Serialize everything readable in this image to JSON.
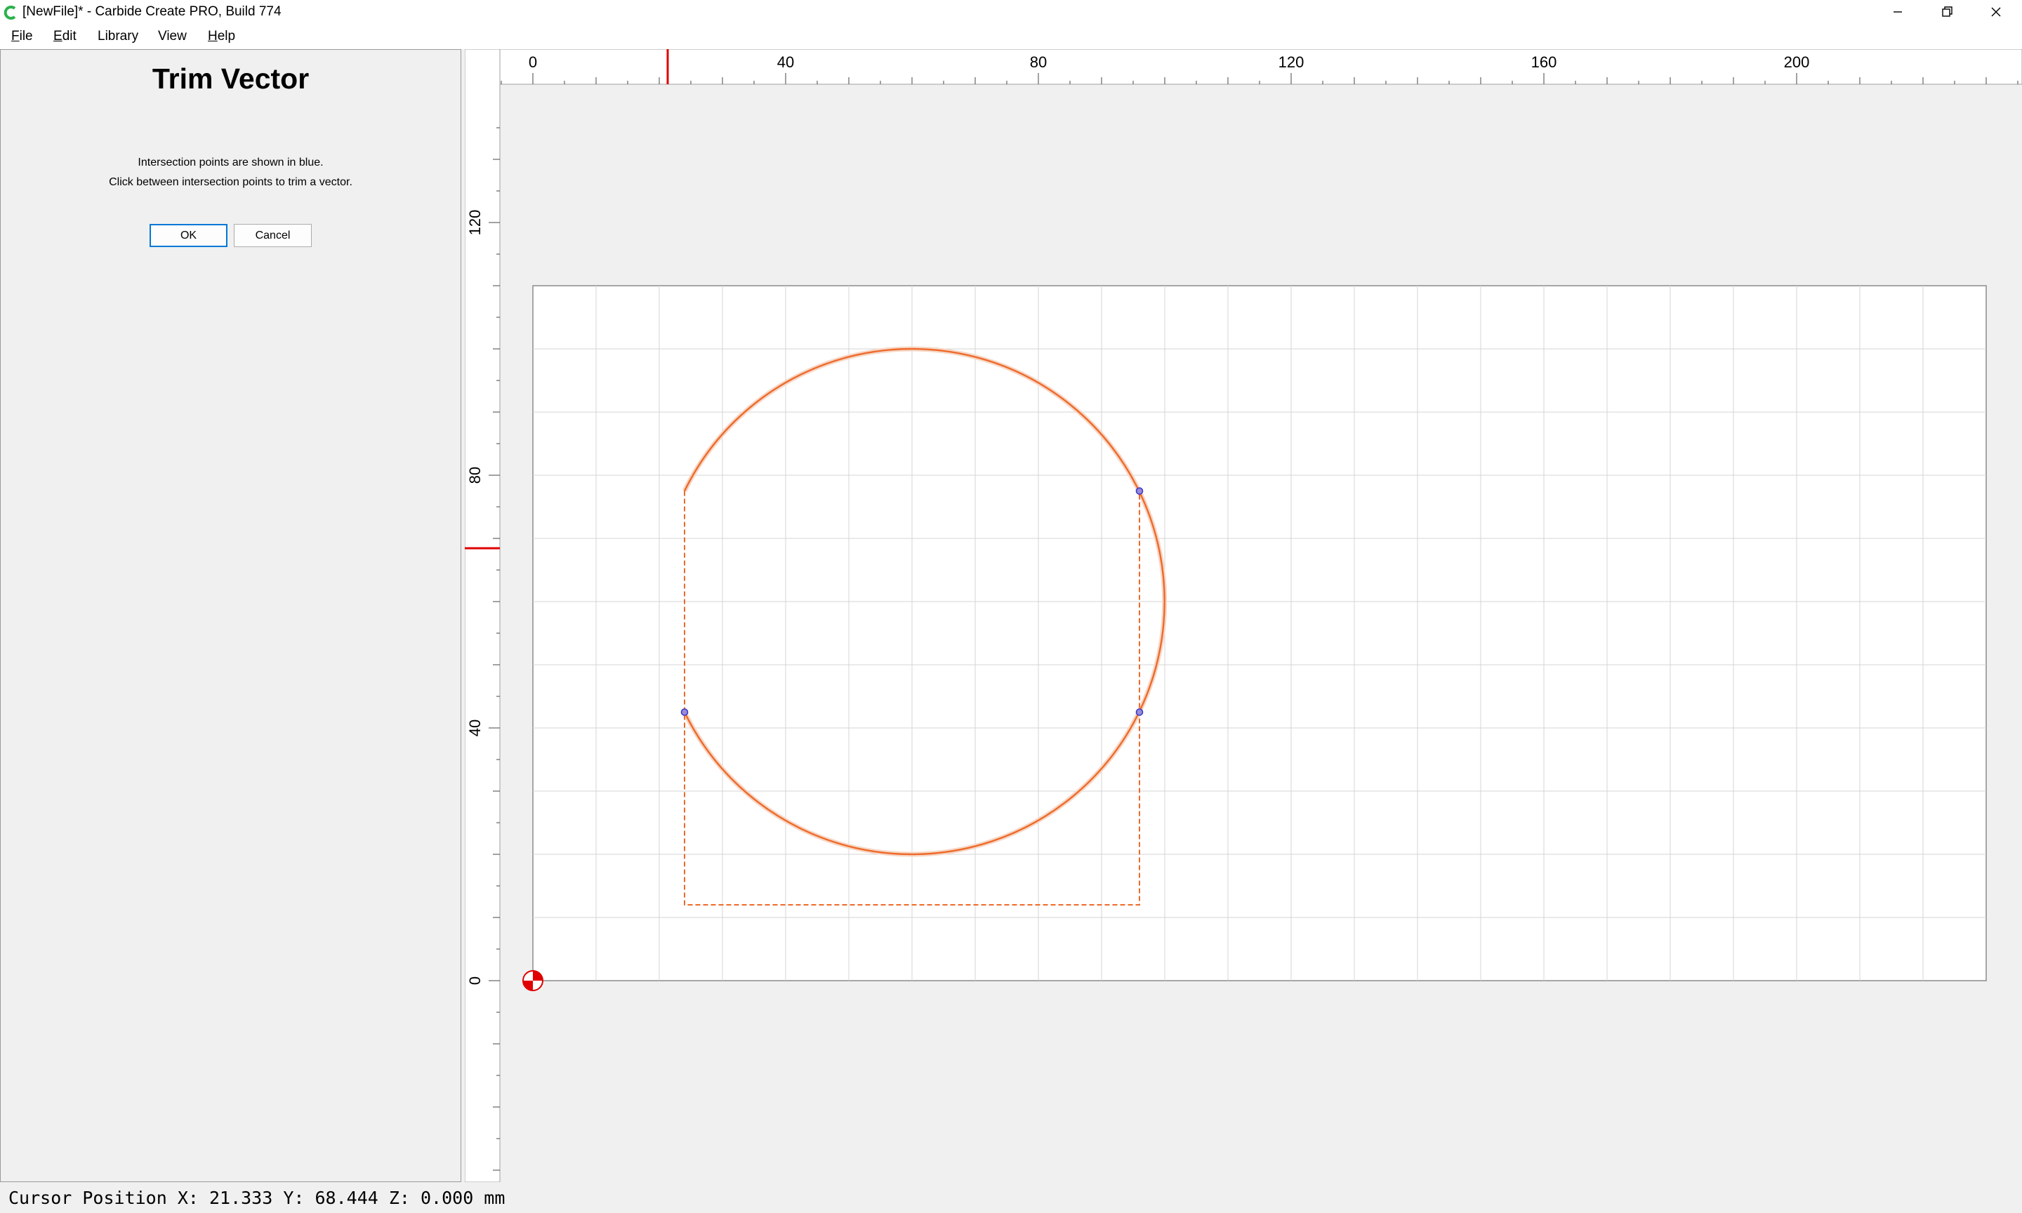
{
  "window": {
    "title": "[NewFile]* - Carbide Create PRO, Build 774",
    "icon": "carbide-c-icon",
    "controls": [
      "minimize-icon",
      "restore-icon",
      "close-icon"
    ]
  },
  "menu": {
    "items": [
      {
        "label": "File",
        "hotkey": "F",
        "rest": "ile"
      },
      {
        "label": "Edit",
        "hotkey": "E",
        "rest": "dit"
      },
      {
        "label": "Library",
        "hotkey": "",
        "rest": "Library"
      },
      {
        "label": "View",
        "hotkey": "",
        "rest": "View"
      },
      {
        "label": "Help",
        "hotkey": "H",
        "rest": "elp"
      }
    ]
  },
  "panel": {
    "title": "Trim Vector",
    "info_line_1": "Intersection points are shown in blue.",
    "info_line_2": "Click between intersection points to trim a vector.",
    "ok_label": "OK",
    "cancel_label": "Cancel"
  },
  "canvas": {
    "units": "mm",
    "stock_width": 230,
    "stock_height": 110,
    "grid_step": 10,
    "x_ticks": [
      "0",
      "40",
      "80",
      "120",
      "160",
      "200"
    ],
    "y_ticks": [
      "0",
      "40",
      "80",
      "120"
    ],
    "cursor_marker": {
      "x": 21.333,
      "y": 68.444
    },
    "circle": {
      "cx": 60,
      "cy": 60,
      "r": 40
    },
    "trimmed_rect": {
      "x0": 24,
      "y0": 12,
      "x1": 96,
      "y1": 77.5
    },
    "intersection_points": [
      {
        "x": 96,
        "y": 77.5
      },
      {
        "x": 24,
        "y": 42.5
      },
      {
        "x": 96,
        "y": 42.5
      }
    ],
    "colors": {
      "vector": "#ee6a2a",
      "intersection": "#3c3cc8",
      "grid": "#d4d4d4",
      "cursor": "#e00000",
      "origin": "#e00000"
    }
  },
  "status": {
    "cursor_position": "Cursor Position X: 21.333 Y: 68.444 Z: 0.000 mm"
  }
}
